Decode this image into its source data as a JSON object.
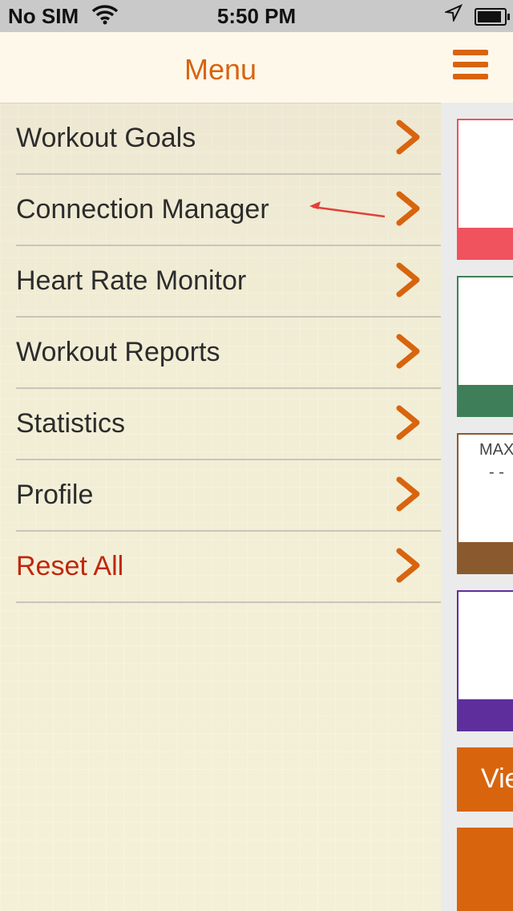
{
  "status_bar": {
    "carrier": "No SIM",
    "time": "5:50 PM",
    "battery_level": 0.8
  },
  "menu": {
    "title": "Menu",
    "items": [
      {
        "label": "Workout Goals"
      },
      {
        "label": "Connection Manager"
      },
      {
        "label": "Heart Rate Monitor"
      },
      {
        "label": "Workout Reports"
      },
      {
        "label": "Statistics"
      },
      {
        "label": "Profile"
      },
      {
        "label": "Reset All"
      }
    ]
  },
  "main": {
    "cards": [
      {
        "color": "#f0525e"
      },
      {
        "color": "#3e7f59"
      },
      {
        "color": "#8a5a2e",
        "label": "MAX",
        "value": "- -"
      },
      {
        "color": "#5e2f9c"
      }
    ],
    "view_button_label": "Vie",
    "accent": "#d8640e"
  }
}
